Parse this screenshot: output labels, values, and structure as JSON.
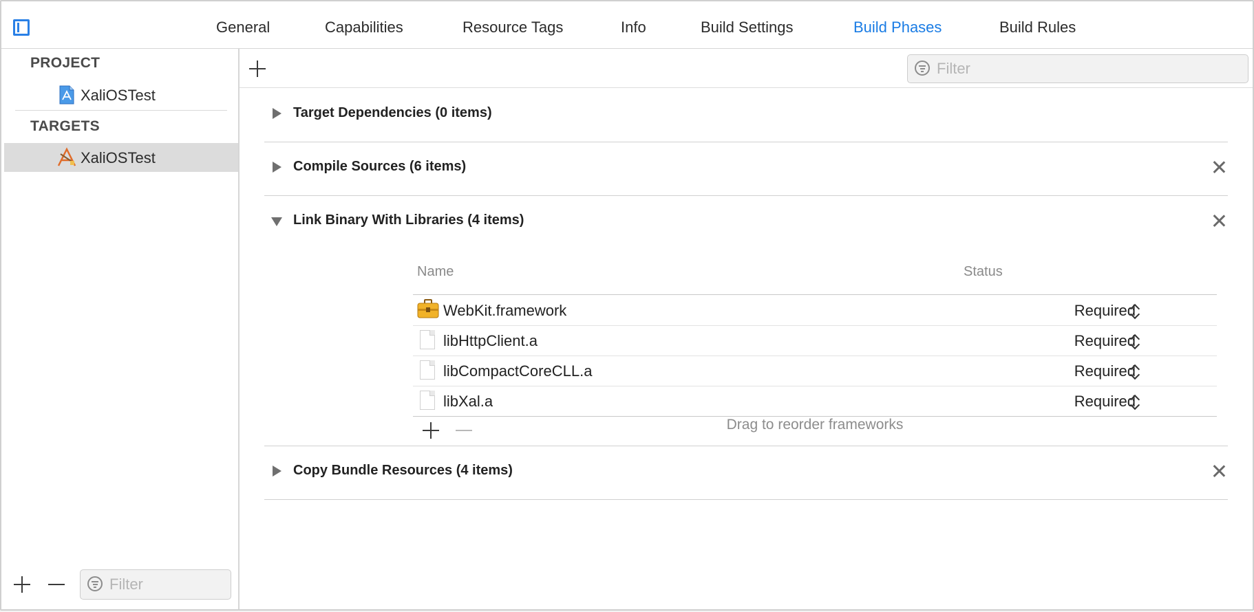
{
  "tabs": [
    {
      "label": "General"
    },
    {
      "label": "Capabilities"
    },
    {
      "label": "Resource Tags"
    },
    {
      "label": "Info"
    },
    {
      "label": "Build Settings"
    },
    {
      "label": "Build Phases",
      "active": true
    },
    {
      "label": "Build Rules"
    }
  ],
  "sidebar": {
    "project_header": "PROJECT",
    "project_item": "XaliOSTest",
    "targets_header": "TARGETS",
    "target_item": "XaliOSTest",
    "filter_placeholder": "Filter"
  },
  "main": {
    "filter_placeholder": "Filter",
    "phases": [
      {
        "title": "Target Dependencies (0 items)",
        "expanded": false,
        "removable": false
      },
      {
        "title": "Compile Sources (6 items)",
        "expanded": false,
        "removable": true
      },
      {
        "title": "Link Binary With Libraries (4 items)",
        "expanded": true,
        "removable": true
      },
      {
        "title": "Copy Bundle Resources (4 items)",
        "expanded": false,
        "removable": true
      }
    ],
    "libraries": {
      "col_name": "Name",
      "col_status": "Status",
      "rows": [
        {
          "name": "WebKit.framework",
          "status": "Required",
          "icon": "framework-toolbox-icon"
        },
        {
          "name": "libHttpClient.a",
          "status": "Required",
          "icon": "file-icon"
        },
        {
          "name": "libCompactCoreCLL.a",
          "status": "Required",
          "icon": "file-icon"
        },
        {
          "name": "libXal.a",
          "status": "Required",
          "icon": "file-icon"
        }
      ],
      "footer_hint": "Drag to reorder frameworks"
    }
  },
  "colors": {
    "accent": "#1a7ce4",
    "selected_row": "#dcdcdc"
  }
}
